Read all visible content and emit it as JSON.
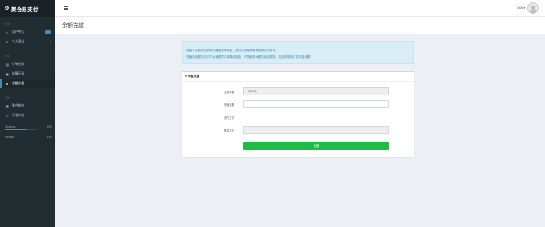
{
  "app": {
    "logo_mark": "Ɖ",
    "title": "聚合易支付"
  },
  "sidebar": {
    "sections": [
      {
        "label": "导航"
      },
      {
        "label": "财务"
      },
      {
        "label": "其他"
      }
    ],
    "items": [
      {
        "label": "用户中心",
        "icon": "home-icon",
        "glyph": "⌂",
        "badge": true
      },
      {
        "label": "个人资料",
        "icon": "user-icon",
        "glyph": "✎",
        "chevron": "‹"
      },
      {
        "label": "订单记录",
        "icon": "list-icon",
        "glyph": "▤"
      },
      {
        "label": "结算记录",
        "icon": "settlement-icon",
        "glyph": "▣"
      },
      {
        "label": "余额充值",
        "icon": "yen-icon",
        "glyph": "¥"
      },
      {
        "label": "聚合收款",
        "icon": "qrcode-icon",
        "glyph": "▦"
      },
      {
        "label": "开发文档",
        "icon": "document-icon",
        "glyph": "✐"
      }
    ],
    "stats": [
      {
        "label": "Windows",
        "value": "69%",
        "fraction": 0.69,
        "color": "#3c8dbc"
      },
      {
        "label": "Release",
        "value": "33%",
        "fraction": 0.33,
        "color": "#3c8dbc"
      }
    ]
  },
  "topbar": {
    "menu_icon": "hamburger-icon",
    "user_id": "1000",
    "caret": "▾",
    "avatar_icon": "avatar-icon"
  },
  "page": {
    "title": "余额充值",
    "notice_line1": "充值手续费按当前商户通道费率收取，支付后到账请联系客服进行补单。",
    "notice_line2": "充值的余额仅用于平台消费项订单退款抵金，严禁就繁大额充值后提现，否则封禁商户并冻结余额！"
  },
  "recharge_form": {
    "title": "¥ 余额充值",
    "current_balance_label": "当前余额",
    "current_balance_value": "0.00 元",
    "amount_label": "充值金额",
    "amount_value": "",
    "method_label": "支付方式",
    "captcha_label": "购买支付",
    "captcha_value": "",
    "submit_label": "充值"
  },
  "colors": {
    "sidebar_bg": "#222d32",
    "accent": "#3c8dbc",
    "submit": "#1dbe47",
    "notice_bg": "#d9edf7"
  }
}
